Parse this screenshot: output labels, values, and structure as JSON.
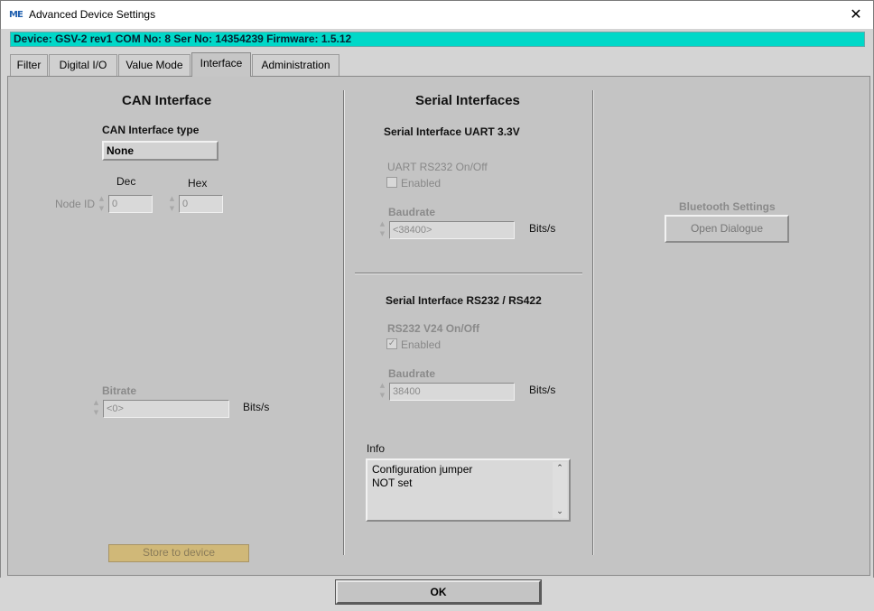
{
  "window": {
    "app_icon": "ME",
    "title": "Advanced Device Settings",
    "close_glyph": "✕"
  },
  "device_bar": "Device: GSV-2 rev1 COM No: 8 Ser No: 14354239 Firmware: 1.5.12",
  "tabs": [
    {
      "label": "Filter"
    },
    {
      "label": "Digital I/O"
    },
    {
      "label": "Value Mode"
    },
    {
      "label": "Interface",
      "active": true
    },
    {
      "label": "Administration"
    }
  ],
  "can": {
    "heading": "CAN Interface",
    "type_label": "CAN Interface type",
    "type_value": "None",
    "dec_label": "Dec",
    "hex_label": "Hex",
    "node_id_label": "Node ID",
    "node_id_dec": "0",
    "node_id_hex": "0",
    "bitrate_label": "Bitrate",
    "bitrate_value": "<0>",
    "bitrate_unit": "Bits/s",
    "store_button": "Store to device"
  },
  "serial": {
    "heading": "Serial Interfaces",
    "uart": {
      "heading": "Serial Interface UART 3.3V",
      "toggle_label": "UART RS232 On/Off",
      "checkbox_label": "Enabled",
      "checked": false,
      "baud_label": "Baudrate",
      "baud_value": "<38400>",
      "baud_unit": "Bits/s"
    },
    "rs232": {
      "heading": "Serial Interface RS232 / RS422",
      "toggle_label": "RS232 V24 On/Off",
      "checkbox_label": "Enabled",
      "checked": true,
      "baud_label": "Baudrate",
      "baud_value": "38400",
      "baud_unit": "Bits/s"
    },
    "info_label": "Info",
    "info_text": "Configuration jumper\nNOT set"
  },
  "bluetooth": {
    "heading": "Bluetooth Settings",
    "button": "Open Dialogue"
  },
  "ok_button": "OK",
  "colors": {
    "device_bar": "#00d8c8",
    "store_button": "#d0b878",
    "panel": "#c4c4c4"
  }
}
